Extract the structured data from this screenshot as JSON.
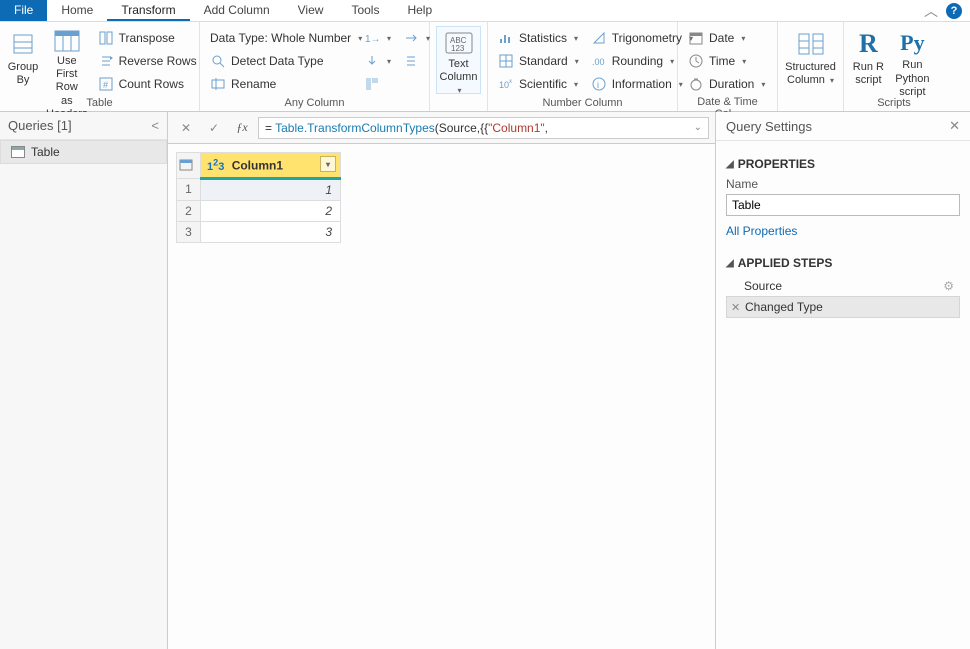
{
  "tabs": {
    "file": "File",
    "home": "Home",
    "transform": "Transform",
    "add_column": "Add Column",
    "view": "View",
    "tools": "Tools",
    "help": "Help"
  },
  "ribbon": {
    "table": {
      "group_by": "Group\nBy",
      "use_headers": "Use First Row\nas Headers",
      "transpose": "Transpose",
      "reverse": "Reverse Rows",
      "count": "Count Rows",
      "label": "Table"
    },
    "anycol": {
      "data_type": "Data Type: Whole Number",
      "detect": "Detect Data Type",
      "rename": "Rename",
      "label": "Any Column"
    },
    "textcol": {
      "text_column": "Text\nColumn",
      "label": ""
    },
    "numcol": {
      "statistics": "Statistics",
      "standard": "Standard",
      "scientific": "Scientific",
      "trig": "Trigonometry",
      "rounding": "Rounding",
      "info": "Information",
      "label": "Number Column"
    },
    "datecol": {
      "date": "Date",
      "time": "Time",
      "duration": "Duration",
      "label": "Date & Time Col..."
    },
    "structured": {
      "structured": "Structured\nColumn",
      "label": ""
    },
    "scripts": {
      "run_r": "Run R\nscript",
      "run_py": "Run Python\nscript",
      "label": "Scripts"
    }
  },
  "queries": {
    "title": "Queries [1]",
    "items": [
      {
        "name": "Table"
      }
    ]
  },
  "formula": {
    "prefix": "= ",
    "fn1": "Table.TransformColumnTypes",
    "mid": "(Source,{{",
    "str": "\"Column1\"",
    "suffix": ","
  },
  "grid": {
    "column": "Column1",
    "rows": [
      {
        "n": 1,
        "v": "1"
      },
      {
        "n": 2,
        "v": "2"
      },
      {
        "n": 3,
        "v": "3"
      }
    ]
  },
  "settings": {
    "title": "Query Settings",
    "properties_label": "PROPERTIES",
    "name_label": "Name",
    "name_value": "Table",
    "all_properties": "All Properties",
    "applied_steps_label": "APPLIED STEPS",
    "steps": [
      {
        "name": "Source",
        "gear": true
      },
      {
        "name": "Changed Type",
        "x": true
      }
    ]
  }
}
